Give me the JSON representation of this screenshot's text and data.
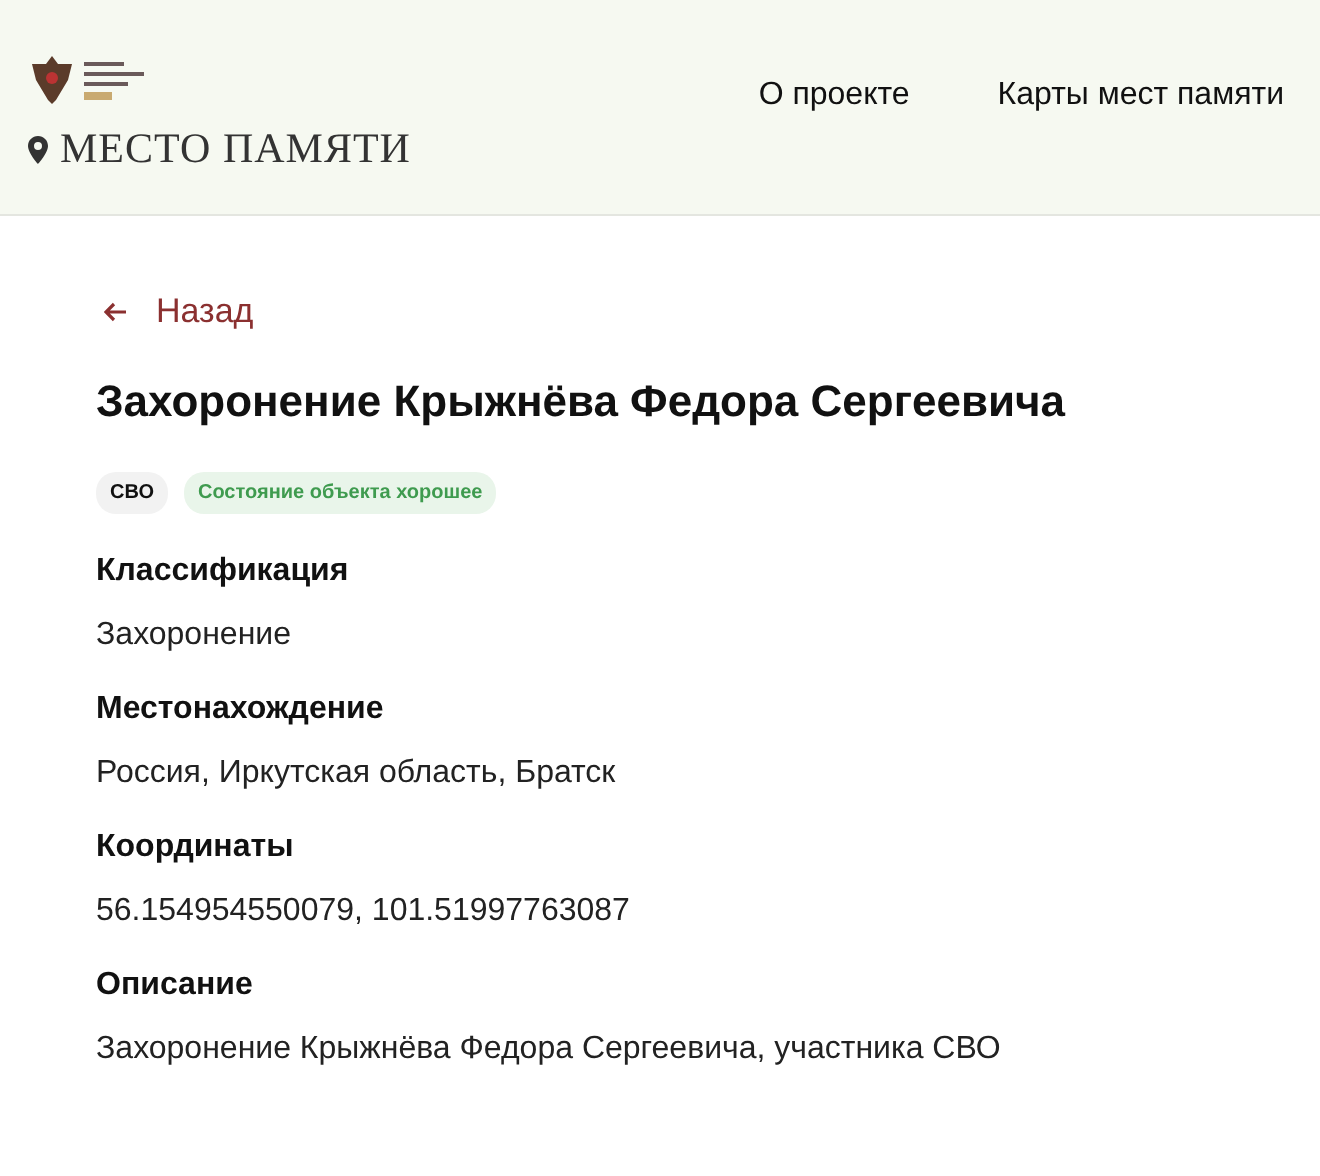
{
  "header": {
    "site_title": "МЕСТО ПАМЯТИ",
    "nav": [
      {
        "label": "О проекте"
      },
      {
        "label": "Карты мест памяти"
      }
    ]
  },
  "back_link": "Назад",
  "title": "Захоронение Крыжнёва Федора Сергеевича",
  "tags": [
    {
      "label": "СВО",
      "kind": "category"
    },
    {
      "label": "Состояние объекта хорошее",
      "kind": "status"
    }
  ],
  "fields": [
    {
      "label": "Классификация",
      "value": "Захоронение"
    },
    {
      "label": "Местонахождение",
      "value": "Россия, Иркутская область, Братск"
    },
    {
      "label": "Координаты",
      "value": "56.154954550079, 101.51997763087"
    },
    {
      "label": "Описание",
      "value": "Захоронение Крыжнёва Федора Сергеевича, участника СВО"
    }
  ]
}
